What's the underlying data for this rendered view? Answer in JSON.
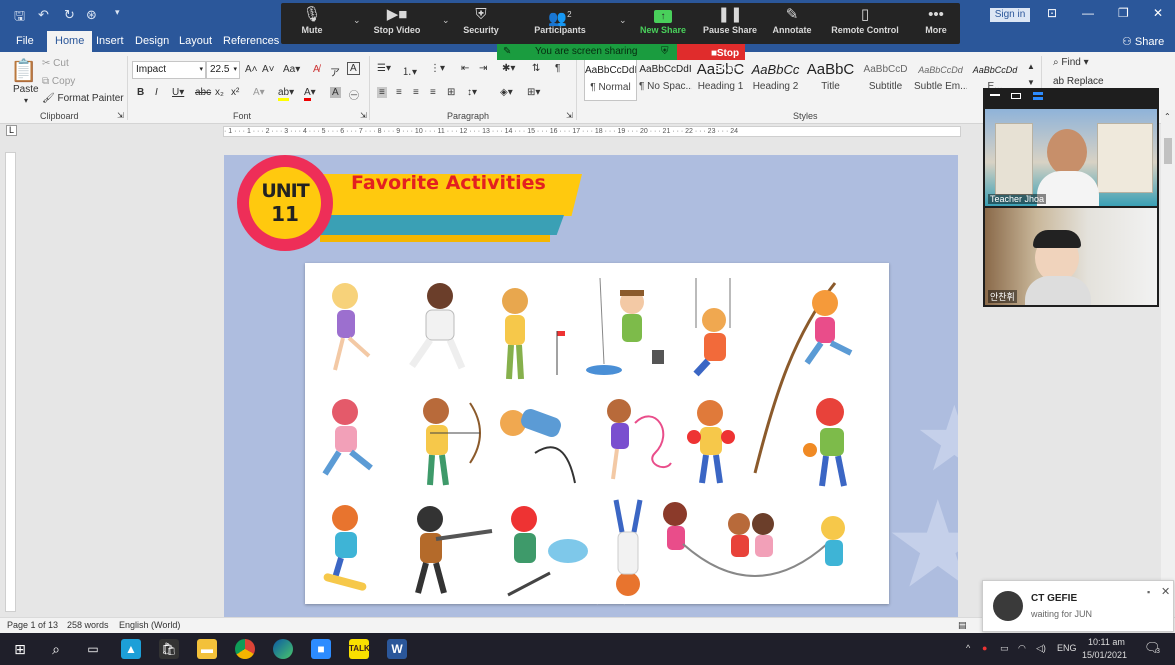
{
  "titlebar": {
    "signin_label": "Sign in",
    "share_label": "Share"
  },
  "zoom_toolbar": {
    "items": [
      {
        "label": "Mute",
        "icon": "mic-icon"
      },
      {
        "label": "Stop Video",
        "icon": "video-camera-icon"
      },
      {
        "label": "Security",
        "icon": "shield-icon"
      },
      {
        "label": "Participants",
        "icon": "participants-icon",
        "count": "2"
      },
      {
        "label": "New Share",
        "icon": "share-screen-icon"
      },
      {
        "label": "Pause Share",
        "icon": "pause-icon"
      },
      {
        "label": "Annotate",
        "icon": "pen-icon"
      },
      {
        "label": "Remote Control",
        "icon": "mouse-icon"
      },
      {
        "label": "More",
        "icon": "ellipsis-icon"
      }
    ],
    "sharing_text": "You are screen sharing",
    "stop_share": "Stop Share"
  },
  "tabs": [
    "File",
    "Home",
    "Insert",
    "Design",
    "Layout",
    "References"
  ],
  "ribbon": {
    "clipboard": {
      "paste": "Paste",
      "cut": "Cut",
      "copy": "Copy",
      "format_painter": "Format Painter",
      "label": "Clipboard"
    },
    "font": {
      "name": "Impact",
      "size": "22.5",
      "label": "Font"
    },
    "paragraph_label": "Paragraph",
    "styles": {
      "label": "Styles",
      "items": [
        {
          "preview": "AaBbCcDdI",
          "name": "¶ Normal"
        },
        {
          "preview": "AaBbCcDdI",
          "name": "¶ No Spac..."
        },
        {
          "preview": "AaBbC",
          "name": "Heading 1"
        },
        {
          "preview": "AaBbCc",
          "name": "Heading 2"
        },
        {
          "preview": "AaBbC",
          "name": "Title"
        },
        {
          "preview": "AaBbCcD",
          "name": "Subtitle"
        },
        {
          "preview": "AaBbCcDd",
          "name": "Subtle Em..."
        },
        {
          "preview": "AaBbCcDd",
          "name": "E..."
        }
      ]
    },
    "editing": {
      "find": "Find",
      "replace": "Replace"
    }
  },
  "ruler_text": "· 1 · · · 1 · · · 2 · · · 3 · · · 4 · · · 5 · · · 6 · · · 7 · · · 8 · · · 9 · · · 10 · · · 11 · · · 12 · · · 13 · · · 14 · · · 15 · · · 16 · · · 17 · · · 18 · · · 19 · · · 20 · · · 21 · · · 22 · · · 23 · · · 24",
  "document": {
    "unit_word": "UNIT",
    "unit_number": "11",
    "title": "Favorite Activities"
  },
  "video": {
    "tile1_name": "Teacher Jhoa",
    "tile2_name": "안찬휘"
  },
  "statusbar": {
    "page": "Page 1 of 13",
    "words": "258 words",
    "language": "English (World)"
  },
  "notification": {
    "title": "CT GEFIE",
    "subtitle": "waiting for JUN"
  },
  "taskbar": {
    "lang": "ENG",
    "time": "10:11 am",
    "date": "15/01/2021",
    "badge": "3"
  },
  "colors": {
    "word_blue": "#2b579a",
    "zoom_dark": "#242424",
    "share_green": "#1a9c3f",
    "stop_red": "#e02c2c",
    "unit_pink": "#ee2e58",
    "unit_yellow": "#ffc90e",
    "title_red": "#e32020",
    "page_blue": "#aebddf"
  }
}
